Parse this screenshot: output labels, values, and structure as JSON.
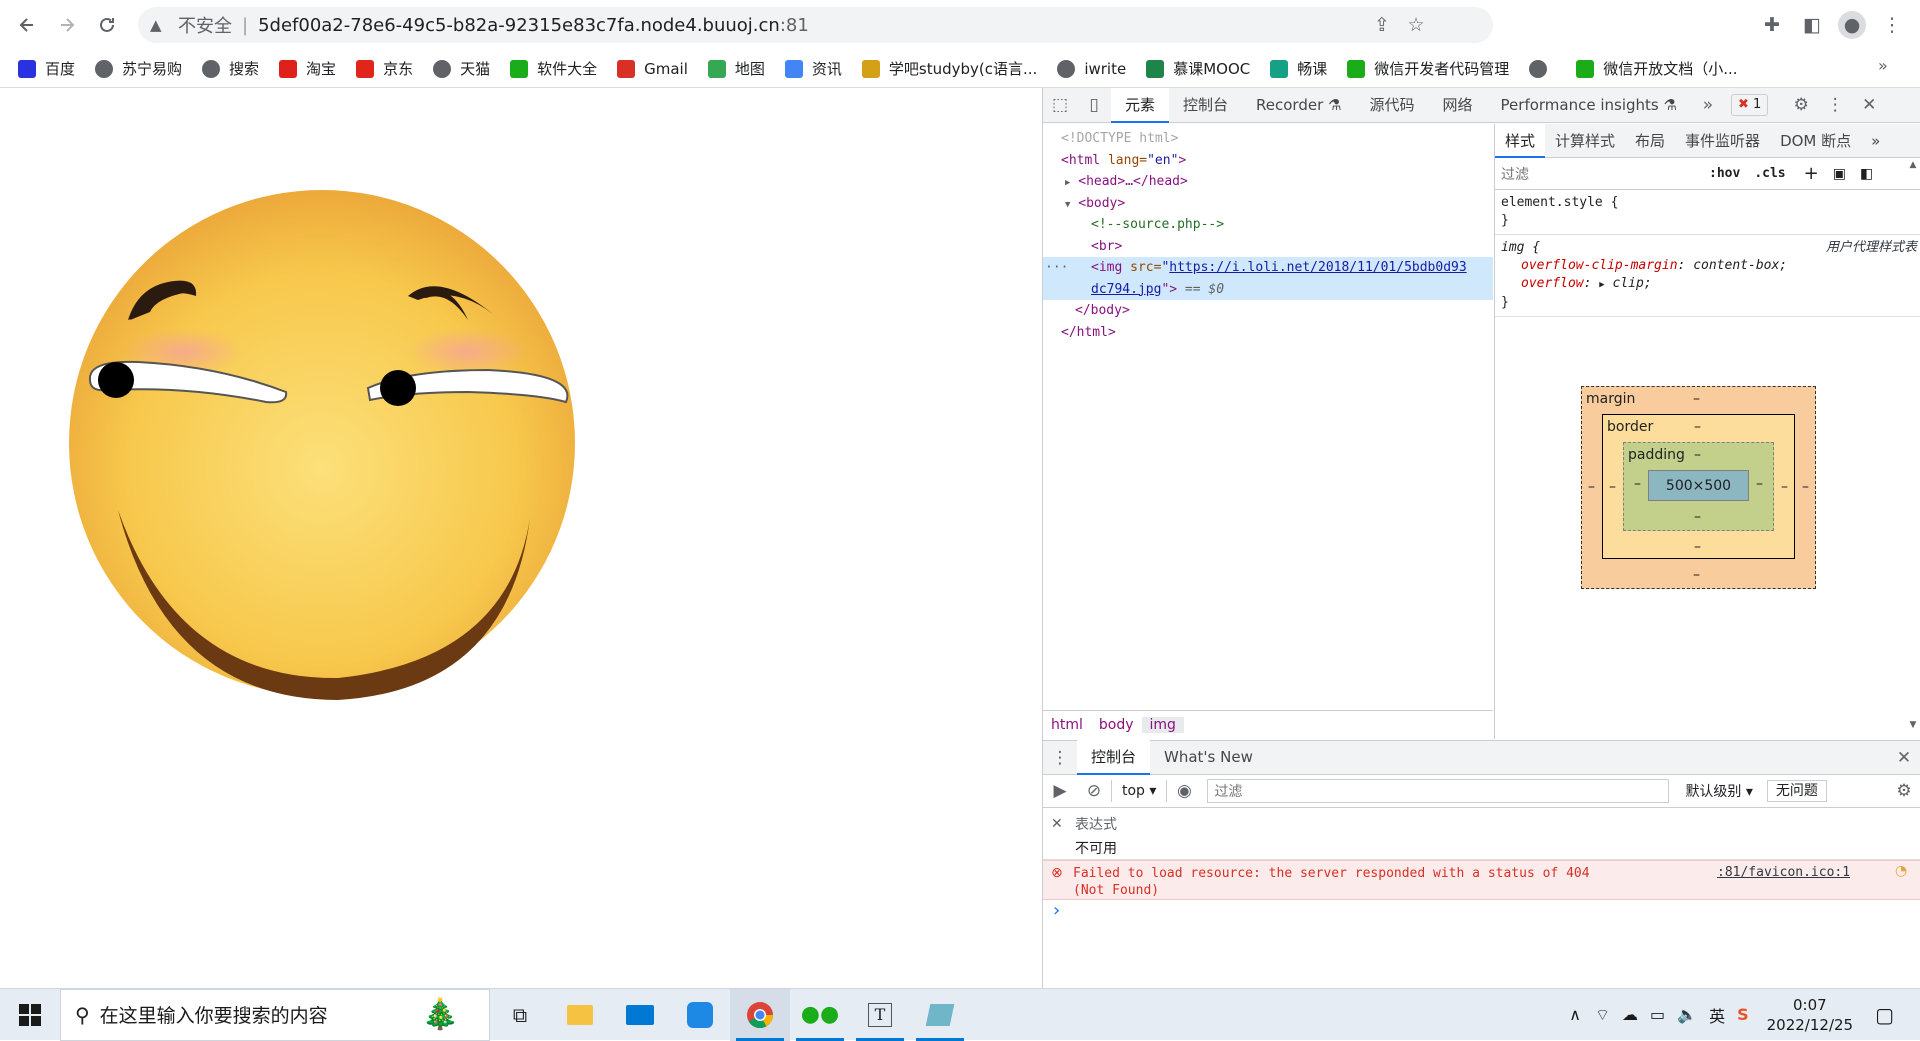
{
  "browser": {
    "insecure_label": "不安全",
    "url_host": "5def00a2-78e6-49c5-b82a-92315e83c7fa.node4.buuoj.cn",
    "url_port": ":81",
    "bookmarks": [
      {
        "label": "百度",
        "icon": "paw-icon",
        "color": "#2932e1"
      },
      {
        "label": "苏宁易购",
        "icon": "globe-icon",
        "color": "#5f6368"
      },
      {
        "label": "搜索",
        "icon": "globe-icon",
        "color": "#5f6368"
      },
      {
        "label": "淘宝",
        "icon": "taobao-icon",
        "color": "#e0201a"
      },
      {
        "label": "京东",
        "icon": "jd-icon",
        "color": "#e1251b"
      },
      {
        "label": "天猫",
        "icon": "globe-icon",
        "color": "#5f6368"
      },
      {
        "label": "软件大全",
        "icon": "download-icon",
        "color": "#1aad19"
      },
      {
        "label": "Gmail",
        "icon": "gmail-icon",
        "color": "#d93025"
      },
      {
        "label": "地图",
        "icon": "map-icon",
        "color": "#34a853"
      },
      {
        "label": "资讯",
        "icon": "news-icon",
        "color": "#4285f4"
      },
      {
        "label": "学吧studyby(c语言...",
        "icon": "study-icon",
        "color": "#d4a017"
      },
      {
        "label": "iwrite",
        "icon": "globe-icon",
        "color": "#5f6368"
      },
      {
        "label": "慕课MOOC",
        "icon": "mooc-icon",
        "color": "#1e8449"
      },
      {
        "label": "畅课",
        "icon": "runner-icon",
        "color": "#16a085"
      },
      {
        "label": "微信开发者代码管理",
        "icon": "wechat-icon",
        "color": "#1aad19"
      },
      {
        "label": "",
        "icon": "globe-icon",
        "color": "#5f6368"
      },
      {
        "label": "微信开放文档（小...",
        "icon": "wechat-icon",
        "color": "#1aad19"
      }
    ]
  },
  "devtools": {
    "tabs": [
      "元素",
      "控制台",
      "Recorder",
      "源代码",
      "网络",
      "Performance insights"
    ],
    "error_count": "1",
    "dom": {
      "doctype": "<!DOCTYPE html>",
      "html_open": "<html",
      "lang_attr": " lang=",
      "lang_val": "\"en\"",
      "head": "<head>…</head>",
      "body_open": "<body>",
      "comment": "<!--source.php-->",
      "br": "<br>",
      "img_open": "<img",
      "src_attr": " src=",
      "src_val_1": "https://i.loli.net/2018/11/01/5bdb0d93",
      "src_val_2": "dc794.jpg",
      "img_close": "\">",
      "selected_marker": " == $0",
      "body_close": "</body>",
      "html_close": "</html>"
    },
    "breadcrumbs": [
      "html",
      "body",
      "img"
    ],
    "styles_tabs": [
      "样式",
      "计算样式",
      "布局",
      "事件监听器",
      "DOM 断点"
    ],
    "filter_placeholder": "过滤",
    "hov": ":hov",
    "cls": ".cls",
    "element_style": "element.style {",
    "close_brace": "}",
    "img_selector": "img {",
    "ua_label": "用户代理样式表",
    "prop1_name": "overflow-clip-margin",
    "prop1_value": "content-box;",
    "prop2_name": "overflow",
    "prop2_value": "clip;",
    "box_model": {
      "margin_label": "margin",
      "border_label": "border",
      "padding_label": "padding",
      "content_size": "500×500",
      "dash": "–"
    },
    "drawer_tabs": [
      "控制台",
      "What's New"
    ],
    "context": "top",
    "console_filter": "过滤",
    "level": "默认级别",
    "issues": "无问题",
    "expression_label": "表达式",
    "expression_value": "不可用",
    "error_message": "Failed to load resource: the server responded with a status of 404 (Not Found)",
    "error_source": ":81/favicon.ico:1",
    "prompt": "›"
  },
  "taskbar": {
    "search_placeholder": "在这里输入你要搜索的内容",
    "time": "0:07",
    "date": "2022/12/25",
    "ime": "英"
  }
}
